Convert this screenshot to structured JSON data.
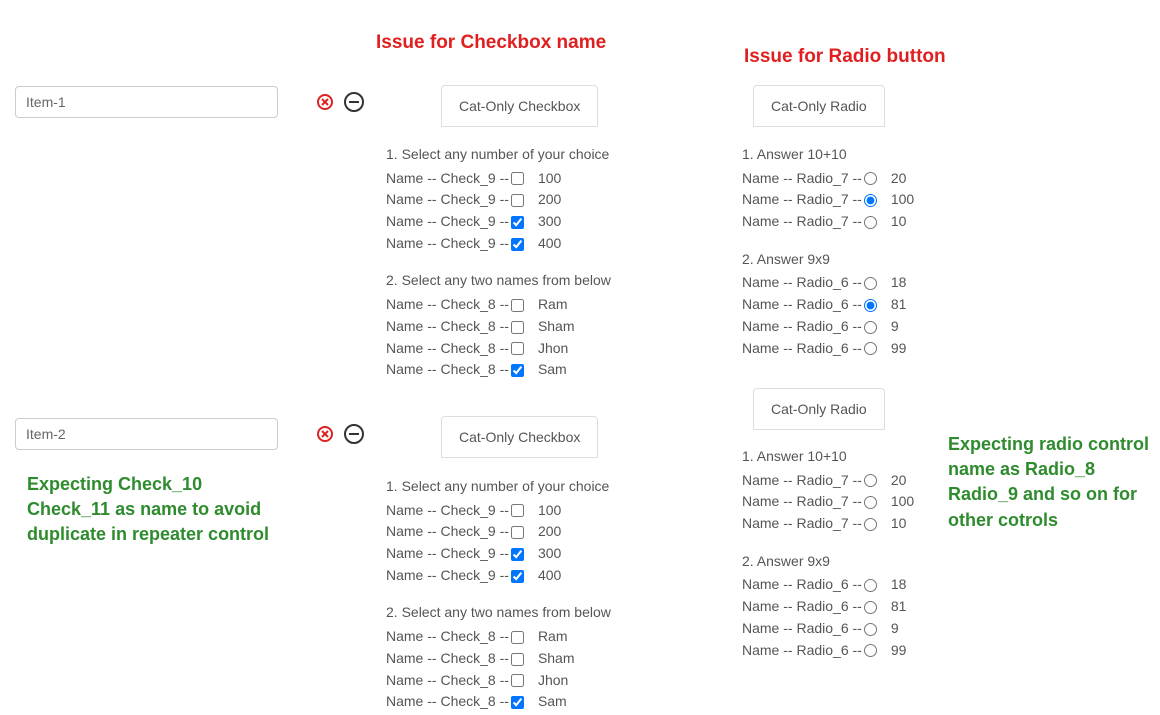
{
  "headings": {
    "checkbox_issue": "Issue for Checkbox name",
    "radio_issue": "Issue for Radio button"
  },
  "notes": {
    "check_note_l1": "Expecting Check_10",
    "check_note_l2": "Check_11 as name to avoid",
    "check_note_l3": "duplicate in repeater control",
    "radio_note_l1": "Expecting radio control",
    "radio_note_l2": "name as Radio_8",
    "radio_note_l3": "Radio_9 and so on for",
    "radio_note_l4": "other cotrols"
  },
  "items": [
    {
      "label": "Item-1"
    },
    {
      "label": "Item-2"
    }
  ],
  "checkbox_panel": {
    "tab_label": "Cat-Only Checkbox",
    "groups": [
      {
        "question": "1.  Select any number of your choice",
        "name": "Check_9",
        "rows": [
          {
            "value": "100",
            "checked": false
          },
          {
            "value": "200",
            "checked": false
          },
          {
            "value": "300",
            "checked": true
          },
          {
            "value": "400",
            "checked": true
          }
        ]
      },
      {
        "question": "2.  Select any two names from below",
        "name": "Check_8",
        "rows": [
          {
            "value": "Ram",
            "checked": false
          },
          {
            "value": "Sham",
            "checked": false
          },
          {
            "value": "Jhon",
            "checked": false
          },
          {
            "value": "Sam",
            "checked": true
          }
        ]
      }
    ]
  },
  "radio_panels": [
    {
      "tab_label": "Cat-Only Radio",
      "groups": [
        {
          "question": "1.  Answer 10+10",
          "name": "Radio_7",
          "rows": [
            {
              "value": "20",
              "checked": false
            },
            {
              "value": "100",
              "checked": true
            },
            {
              "value": "10",
              "checked": false
            }
          ]
        },
        {
          "question": "2.  Answer 9x9",
          "name": "Radio_6",
          "rows": [
            {
              "value": "18",
              "checked": false
            },
            {
              "value": "81",
              "checked": true
            },
            {
              "value": "9",
              "checked": false
            },
            {
              "value": "99",
              "checked": false
            }
          ]
        }
      ]
    },
    {
      "tab_label": "Cat-Only Radio",
      "groups": [
        {
          "question": "1.  Answer 10+10",
          "name": "Radio_7",
          "rows": [
            {
              "value": "20",
              "checked": false
            },
            {
              "value": "100",
              "checked": false
            },
            {
              "value": "10",
              "checked": false
            }
          ]
        },
        {
          "question": "2.  Answer 9x9",
          "name": "Radio_6",
          "rows": [
            {
              "value": "18",
              "checked": false
            },
            {
              "value": "81",
              "checked": false
            },
            {
              "value": "9",
              "checked": false
            },
            {
              "value": "99",
              "checked": false
            }
          ]
        }
      ]
    }
  ],
  "label_prefix": "Name -- ",
  "label_sep": " -- "
}
